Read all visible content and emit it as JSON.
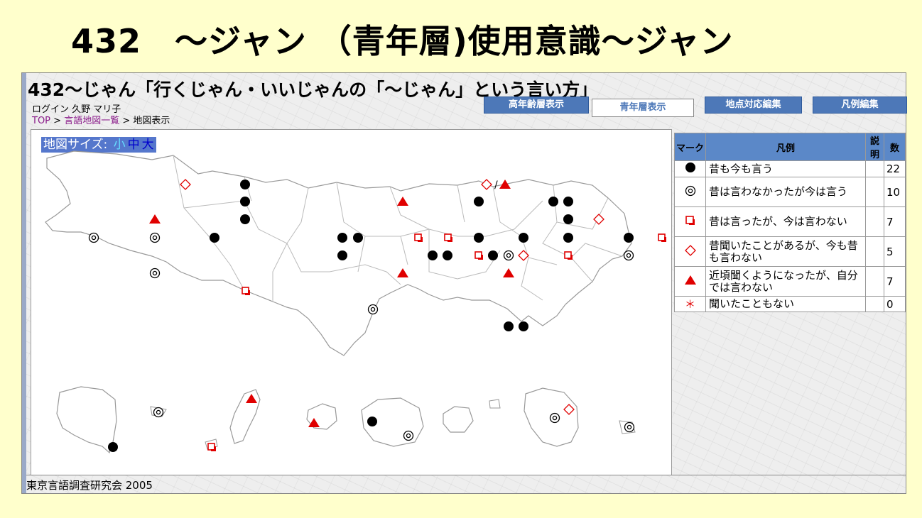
{
  "slide": {
    "title": "432　～ジャン （青年層)使用意識～ジャン"
  },
  "page": {
    "title": "432～じゃん「行くじゃん・いいじゃんの「～じゃん」という言い方」",
    "login": "ログイン 久野 マリ子",
    "breadcrumb": {
      "top": "TOP",
      "sep1": " > ",
      "list": "言語地図一覧",
      "sep2": " > ",
      "current": "地図表示"
    }
  },
  "tabs": [
    {
      "label": "高年齢層表示",
      "active": false
    },
    {
      "label": "青年層表示",
      "active": true
    },
    {
      "label": "地点対応編集",
      "active": false
    },
    {
      "label": "凡例編集",
      "active": false
    }
  ],
  "map_size": {
    "label": "地図サイズ: ",
    "small": "小",
    "medium": "中",
    "large": "大"
  },
  "legend": {
    "headers": {
      "mark": "マーク",
      "label": "凡例",
      "explain": "説明",
      "count": "数"
    },
    "rows": [
      {
        "icon": "filled-circle-icon",
        "label": "昔も今も言う",
        "count": "22"
      },
      {
        "icon": "double-circle-icon",
        "label": "昔は言わなかったが今は言う",
        "count": "10"
      },
      {
        "icon": "shadow-square-icon",
        "label": "昔は言ったが、今は言わない",
        "count": "7"
      },
      {
        "icon": "diamond-icon",
        "label": "昔聞いたことがあるが、今も昔も言わない",
        "count": "5"
      },
      {
        "icon": "triangle-icon",
        "label": "近頃聞くようになったが、自分では言わない",
        "count": "7"
      },
      {
        "icon": "asterisk-icon",
        "label": "聞いたこともない",
        "count": "0"
      }
    ]
  },
  "footer": "東京言語調査研究会 2005",
  "colors": {
    "tab": "#4d78b8",
    "legend_header": "#5b88c8",
    "marker_red": "#e00000",
    "background": "#ffffcc"
  }
}
